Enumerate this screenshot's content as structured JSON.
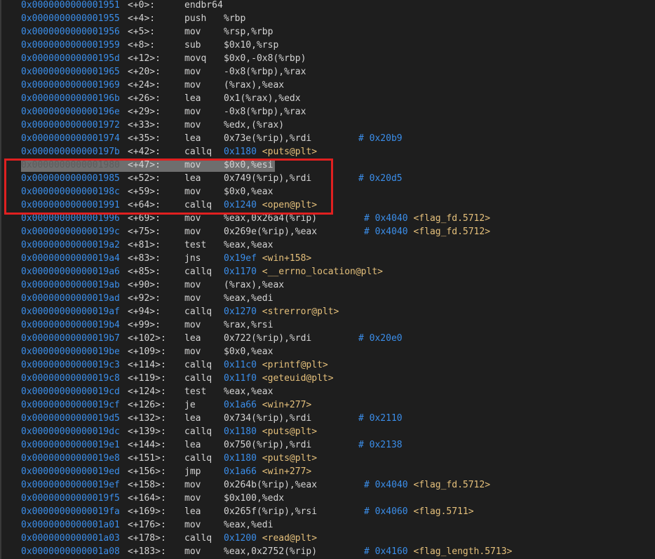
{
  "colors": {
    "background": "#1e1e1e",
    "address": "#3b8eea",
    "symbol": "#e5c07b",
    "text": "#d4d4d4",
    "highlight_box": "#e02020",
    "current_line": "#6e6e6e"
  },
  "current_line_index": 12,
  "annotation": "red-rectangle-highlight",
  "lines": [
    {
      "addr": "0x0000000000001951",
      "off": "<+0>:",
      "mnem": "endbr64",
      "ops": ""
    },
    {
      "addr": "0x0000000000001955",
      "off": "<+4>:",
      "mnem": "push",
      "ops": "%rbp"
    },
    {
      "addr": "0x0000000000001956",
      "off": "<+5>:",
      "mnem": "mov",
      "ops": "%rsp,%rbp"
    },
    {
      "addr": "0x0000000000001959",
      "off": "<+8>:",
      "mnem": "sub",
      "ops": "$0x10,%rsp"
    },
    {
      "addr": "0x000000000000195d",
      "off": "<+12>:",
      "mnem": "movq",
      "ops": "$0x0,-0x8(%rbp)"
    },
    {
      "addr": "0x0000000000001965",
      "off": "<+20>:",
      "mnem": "mov",
      "ops": "-0x8(%rbp),%rax"
    },
    {
      "addr": "0x0000000000001969",
      "off": "<+24>:",
      "mnem": "mov",
      "ops": "(%rax),%eax"
    },
    {
      "addr": "0x000000000000196b",
      "off": "<+26>:",
      "mnem": "lea",
      "ops": "0x1(%rax),%edx"
    },
    {
      "addr": "0x000000000000196e",
      "off": "<+29>:",
      "mnem": "mov",
      "ops": "-0x8(%rbp),%rax"
    },
    {
      "addr": "0x0000000000001972",
      "off": "<+33>:",
      "mnem": "mov",
      "ops": "%edx,(%rax)"
    },
    {
      "addr": "0x0000000000001974",
      "off": "<+35>:",
      "mnem": "lea",
      "ops": "0x73e(%rip),%rdi",
      "comment": "# 0x20b9"
    },
    {
      "addr": "0x000000000000197b",
      "off": "<+42>:",
      "mnem": "callq",
      "target": "0x1180",
      "symbol": "<puts@plt>"
    },
    {
      "addr": "0x0000000000001980",
      "off": "<+47>:",
      "mnem": "mov",
      "ops": "$0x0,%esi"
    },
    {
      "addr": "0x0000000000001985",
      "off": "<+52>:",
      "mnem": "lea",
      "ops": "0x749(%rip),%rdi",
      "comment": "# 0x20d5"
    },
    {
      "addr": "0x000000000000198c",
      "off": "<+59>:",
      "mnem": "mov",
      "ops": "$0x0,%eax"
    },
    {
      "addr": "0x0000000000001991",
      "off": "<+64>:",
      "mnem": "callq",
      "target": "0x1240",
      "symbol": "<open@plt>"
    },
    {
      "addr": "0x0000000000001996",
      "off": "<+69>:",
      "mnem": "mov",
      "ops": "%eax,0x26a4(%rip)",
      "comment": "# 0x4040",
      "symbol": "<flag_fd.5712>"
    },
    {
      "addr": "0x000000000000199c",
      "off": "<+75>:",
      "mnem": "mov",
      "ops": "0x269e(%rip),%eax",
      "comment": "# 0x4040",
      "symbol": "<flag_fd.5712>"
    },
    {
      "addr": "0x00000000000019a2",
      "off": "<+81>:",
      "mnem": "test",
      "ops": "%eax,%eax"
    },
    {
      "addr": "0x00000000000019a4",
      "off": "<+83>:",
      "mnem": "jns",
      "target": "0x19ef",
      "symbol": "<win+158>"
    },
    {
      "addr": "0x00000000000019a6",
      "off": "<+85>:",
      "mnem": "callq",
      "target": "0x1170",
      "symbol": "<__errno_location@plt>"
    },
    {
      "addr": "0x00000000000019ab",
      "off": "<+90>:",
      "mnem": "mov",
      "ops": "(%rax),%eax"
    },
    {
      "addr": "0x00000000000019ad",
      "off": "<+92>:",
      "mnem": "mov",
      "ops": "%eax,%edi"
    },
    {
      "addr": "0x00000000000019af",
      "off": "<+94>:",
      "mnem": "callq",
      "target": "0x1270",
      "symbol": "<strerror@plt>"
    },
    {
      "addr": "0x00000000000019b4",
      "off": "<+99>:",
      "mnem": "mov",
      "ops": "%rax,%rsi"
    },
    {
      "addr": "0x00000000000019b7",
      "off": "<+102>:",
      "mnem": "lea",
      "ops": "0x722(%rip),%rdi",
      "comment": "# 0x20e0"
    },
    {
      "addr": "0x00000000000019be",
      "off": "<+109>:",
      "mnem": "mov",
      "ops": "$0x0,%eax"
    },
    {
      "addr": "0x00000000000019c3",
      "off": "<+114>:",
      "mnem": "callq",
      "target": "0x11c0",
      "symbol": "<printf@plt>"
    },
    {
      "addr": "0x00000000000019c8",
      "off": "<+119>:",
      "mnem": "callq",
      "target": "0x11f0",
      "symbol": "<geteuid@plt>"
    },
    {
      "addr": "0x00000000000019cd",
      "off": "<+124>:",
      "mnem": "test",
      "ops": "%eax,%eax"
    },
    {
      "addr": "0x00000000000019cf",
      "off": "<+126>:",
      "mnem": "je",
      "target": "0x1a66",
      "symbol": "<win+277>"
    },
    {
      "addr": "0x00000000000019d5",
      "off": "<+132>:",
      "mnem": "lea",
      "ops": "0x734(%rip),%rdi",
      "comment": "# 0x2110"
    },
    {
      "addr": "0x00000000000019dc",
      "off": "<+139>:",
      "mnem": "callq",
      "target": "0x1180",
      "symbol": "<puts@plt>"
    },
    {
      "addr": "0x00000000000019e1",
      "off": "<+144>:",
      "mnem": "lea",
      "ops": "0x750(%rip),%rdi",
      "comment": "# 0x2138"
    },
    {
      "addr": "0x00000000000019e8",
      "off": "<+151>:",
      "mnem": "callq",
      "target": "0x1180",
      "symbol": "<puts@plt>"
    },
    {
      "addr": "0x00000000000019ed",
      "off": "<+156>:",
      "mnem": "jmp",
      "target": "0x1a66",
      "symbol": "<win+277>"
    },
    {
      "addr": "0x00000000000019ef",
      "off": "<+158>:",
      "mnem": "mov",
      "ops": "0x264b(%rip),%eax",
      "comment": "# 0x4040",
      "symbol": "<flag_fd.5712>"
    },
    {
      "addr": "0x00000000000019f5",
      "off": "<+164>:",
      "mnem": "mov",
      "ops": "$0x100,%edx"
    },
    {
      "addr": "0x00000000000019fa",
      "off": "<+169>:",
      "mnem": "lea",
      "ops": "0x265f(%rip),%rsi",
      "comment": "# 0x4060",
      "symbol": "<flag.5711>"
    },
    {
      "addr": "0x0000000000001a01",
      "off": "<+176>:",
      "mnem": "mov",
      "ops": "%eax,%edi"
    },
    {
      "addr": "0x0000000000001a03",
      "off": "<+178>:",
      "mnem": "callq",
      "target": "0x1200",
      "symbol": "<read@plt>"
    },
    {
      "addr": "0x0000000000001a08",
      "off": "<+183>:",
      "mnem": "mov",
      "ops": "%eax,0x2752(%rip)",
      "comment": "# 0x4160",
      "symbol": "<flag_length.5713>"
    }
  ]
}
